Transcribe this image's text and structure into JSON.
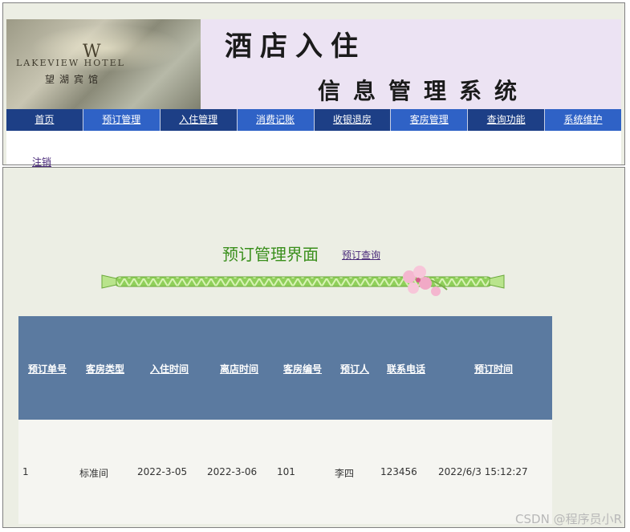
{
  "header": {
    "logo_en": "LAKEVIEW HOTEL",
    "logo_cn": "望湖宾馆",
    "title_line1": "酒店入住",
    "title_line2": "信息管理系统"
  },
  "nav": {
    "items": [
      {
        "label": "首页"
      },
      {
        "label": "预订管理"
      },
      {
        "label": "入住管理"
      },
      {
        "label": "消费记账"
      },
      {
        "label": "收银退房"
      },
      {
        "label": "客房管理"
      },
      {
        "label": "查询功能"
      },
      {
        "label": "系统维护"
      }
    ],
    "logout": "注销"
  },
  "main": {
    "heading": "预订管理界面",
    "query_link": "预订查询"
  },
  "table": {
    "headers": [
      "预订单号",
      "客房类型",
      "入住时间",
      "离店时间",
      "客房编号",
      "预订人",
      "联系电话",
      "预订时间"
    ],
    "rows": [
      [
        "1",
        "标准间",
        "2022-3-05",
        "2022-3-06",
        "101",
        "李四",
        "123456",
        "2022/6/3 15:12:27"
      ]
    ]
  },
  "watermark": "CSDN @程序员小R",
  "colors": {
    "nav_dark": "#1d3f86",
    "nav_light": "#2f62c6",
    "table_header": "#5b7aa0",
    "heading_green": "#3a8f1c",
    "page_bg": "#eceee4"
  }
}
